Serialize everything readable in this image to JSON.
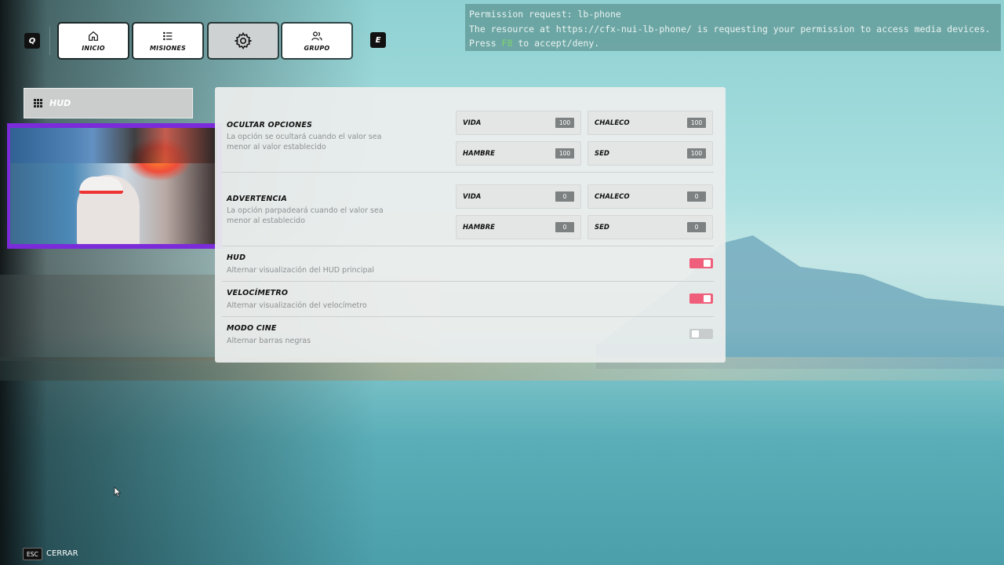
{
  "notification": {
    "line1": "Permission request: lb-phone",
    "line2": "The resource at https://cfx-nui-lb-phone/ is requesting your permission to access media devices.",
    "line3_before": "Press ",
    "line3_key": "F8",
    "line3_after": " to accept/deny."
  },
  "nav": {
    "prev_key": "Q",
    "next_key": "E",
    "tabs": [
      {
        "label": "INICIO",
        "icon": "home-icon"
      },
      {
        "label": "MISIONES",
        "icon": "list-icon"
      },
      {
        "label": "",
        "icon": "gear-icon",
        "active": true
      },
      {
        "label": "GRUPO",
        "icon": "group-icon"
      }
    ]
  },
  "sidebar": {
    "hud_label": "HUD"
  },
  "sections": {
    "ocultar": {
      "title": "OCULTAR OPCIONES",
      "desc": "La opción se ocultará cuando el valor sea menor al valor establecido",
      "fields": [
        {
          "label": "VIDA",
          "value": "100"
        },
        {
          "label": "CHALECO",
          "value": "100"
        },
        {
          "label": "HAMBRE",
          "value": "100"
        },
        {
          "label": "SED",
          "value": "100"
        }
      ]
    },
    "advertencia": {
      "title": "ADVERTENCIA",
      "desc": "La opción parpadeará cuando el valor sea menor al establecido",
      "fields": [
        {
          "label": "VIDA",
          "value": "0"
        },
        {
          "label": "CHALECO",
          "value": "0"
        },
        {
          "label": "HAMBRE",
          "value": "0"
        },
        {
          "label": "SED",
          "value": "0"
        }
      ]
    },
    "hud": {
      "title": "HUD",
      "desc": "Alternar visualización del HUD principal",
      "enabled": true
    },
    "velocimetro": {
      "title": "VELOCÍMETRO",
      "desc": "Alternar visualización del velocímetro",
      "enabled": true
    },
    "modo_cine": {
      "title": "MODO CINE",
      "desc": "Alternar barras negras",
      "enabled": false
    }
  },
  "footer": {
    "esc_key": "ESC",
    "close_label": "CERRAR"
  },
  "colors": {
    "toggle_on": "#ef5e7a",
    "toggle_off": "#c9cccc",
    "webcam_frame": "#7b2bd9"
  }
}
